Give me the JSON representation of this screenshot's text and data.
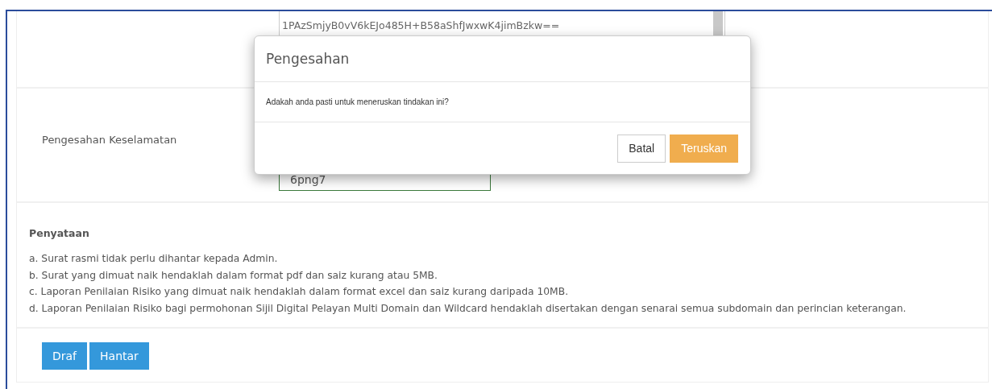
{
  "form": {
    "key_text": "1PAzSmjyB0vV6kEJo485H+B58aShfJwxwK4jimBzkw==",
    "security_label": "Pengesahan Keselamatan",
    "captcha_value": "6png7"
  },
  "statement": {
    "title": "Penyataan",
    "items": [
      "a. Surat rasmi tidak perlu dihantar kepada Admin.",
      "b. Surat yang dimuat naik hendaklah dalam format pdf dan saiz kurang atau 5MB.",
      "c. Laporan Penilaian Risiko yang dimuat naik hendaklah dalam format excel dan saiz kurang daripada 10MB.",
      "d. Laporan Penilaian Risiko bagi permohonan Sijil Digital Pelayan Multi Domain dan Wildcard hendaklah disertakan dengan senarai semua subdomain dan perincian keterangan."
    ]
  },
  "buttons": [
    "Draf",
    "Hantar"
  ],
  "dialog": {
    "title": "Pengesahan",
    "message": "Adakah anda pasti untuk meneruskan tindakan ini?",
    "buttons": [
      {
        "label": "Batal",
        "kind": "default"
      },
      {
        "label": "Teruskan",
        "kind": "primary"
      }
    ]
  }
}
